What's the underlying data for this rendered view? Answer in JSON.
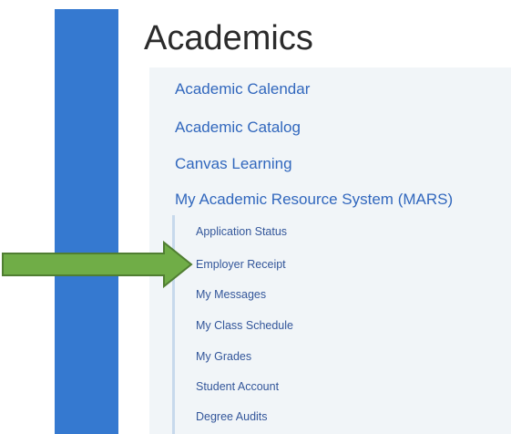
{
  "page": {
    "title": "Academics"
  },
  "colors": {
    "accent_bar": "#3579d0",
    "link": "#3167bd",
    "sub_link": "#33569a",
    "panel_bg": "#f1f5f8",
    "arrow_fill": "#70ad47",
    "arrow_stroke": "#507e32"
  },
  "menu": {
    "items": [
      {
        "label": "Academic Calendar"
      },
      {
        "label": "Academic Catalog"
      },
      {
        "label": "Canvas Learning"
      },
      {
        "label": "My Academic Resource System (MARS)"
      }
    ],
    "mars_submenu": [
      {
        "label": "Application Status"
      },
      {
        "label": "Employer Receipt"
      },
      {
        "label": "My Messages"
      },
      {
        "label": "My Class Schedule"
      },
      {
        "label": "My Grades"
      },
      {
        "label": "Student Account"
      },
      {
        "label": "Degree Audits"
      }
    ]
  },
  "annotation": {
    "icon": "green-arrow-right-icon",
    "points_to": "Employer Receipt"
  }
}
